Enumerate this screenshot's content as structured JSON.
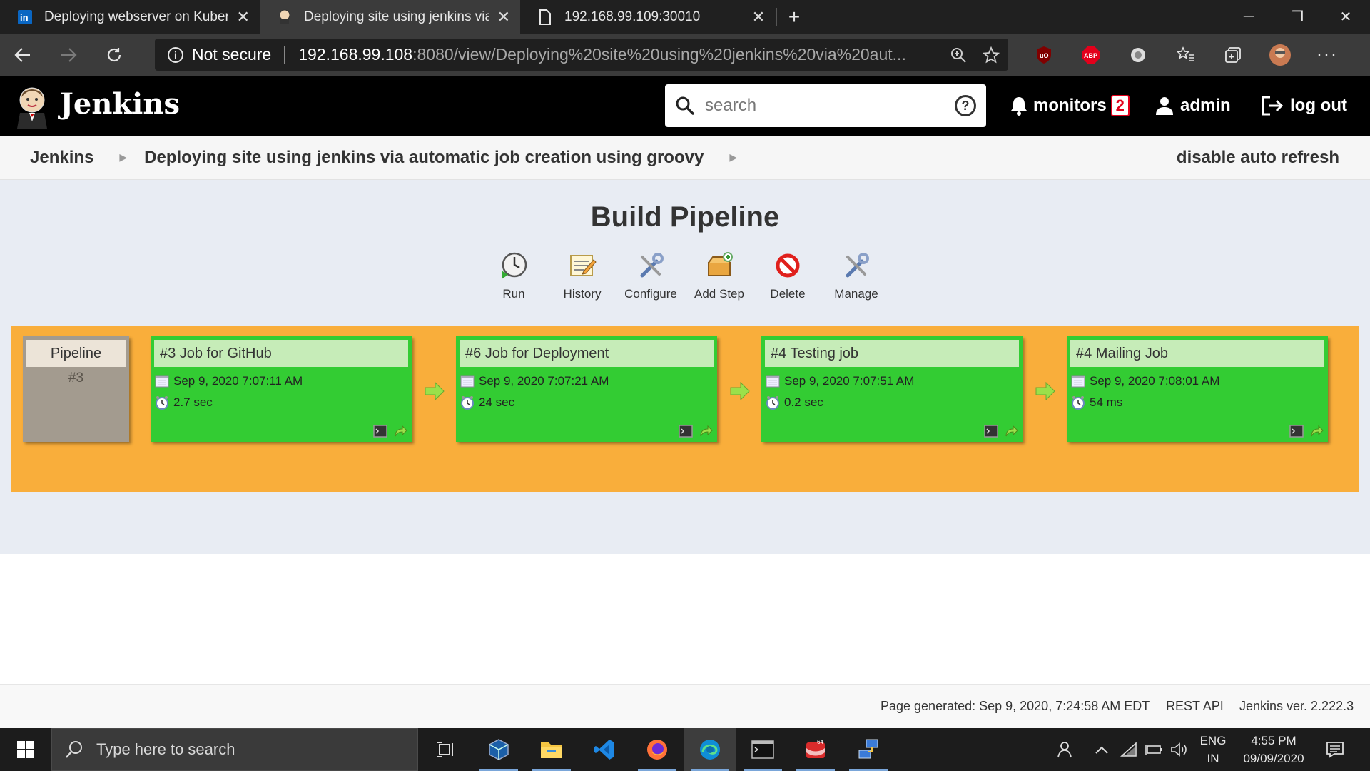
{
  "browser": {
    "tabs": [
      {
        "title": "Deploying webserver on Kubernetes",
        "icon": "linkedin-icon"
      },
      {
        "title": "Deploying site using jenkins via automatic job creation using groovy",
        "icon": "jenkins-icon"
      },
      {
        "title": "192.168.99.109:30010",
        "icon": "page-icon"
      }
    ],
    "address": {
      "security_label": "Not secure",
      "host": "192.168.99.108",
      "path": ":8080/view/Deploying%20site%20using%20jenkins%20via%20aut..."
    },
    "extensions": [
      "ublock-icon",
      "adblock-icon",
      "extension-circle-icon"
    ],
    "colors": {
      "tab_strip": "#202020",
      "toolbar": "#3b3b3b"
    }
  },
  "jenkins": {
    "brand": "Jenkins",
    "search_placeholder": "search",
    "monitors_label": "monitors",
    "monitors_count": "2",
    "user_label": "admin",
    "logout_label": "log out"
  },
  "breadcrumb": {
    "root": "Jenkins",
    "view": "Deploying site using jenkins via automatic job creation using groovy",
    "auto_refresh": "disable auto refresh"
  },
  "pipeline": {
    "title": "Build Pipeline",
    "actions": [
      {
        "label": "Run",
        "icon": "run-icon"
      },
      {
        "label": "History",
        "icon": "history-icon"
      },
      {
        "label": "Configure",
        "icon": "configure-icon"
      },
      {
        "label": "Add Step",
        "icon": "add-step-icon"
      },
      {
        "label": "Delete",
        "icon": "delete-icon"
      },
      {
        "label": "Manage",
        "icon": "manage-icon"
      }
    ],
    "head": {
      "label": "Pipeline",
      "number": "#3"
    },
    "jobs": [
      {
        "title": "#3 Job for GitHub",
        "date": "Sep 9, 2020 7:07:11 AM",
        "duration": "2.7 sec",
        "status": "success"
      },
      {
        "title": "#6 Job for Deployment",
        "date": "Sep 9, 2020 7:07:21 AM",
        "duration": "24 sec",
        "status": "success"
      },
      {
        "title": "#4 Testing job",
        "date": "Sep 9, 2020 7:07:51 AM",
        "duration": "0.2 sec",
        "status": "success"
      },
      {
        "title": "#4 Mailing Job",
        "date": "Sep 9, 2020 7:08:01 AM",
        "duration": "54 ms",
        "status": "success"
      }
    ],
    "colors": {
      "pipeline_bg": "#f9ae3b",
      "job_success": "#33cc33",
      "job_header": "#c6ecb8"
    }
  },
  "footer": {
    "generated": "Page generated: Sep 9, 2020, 7:24:58 AM EDT",
    "rest_api": "REST API",
    "version": "Jenkins ver. 2.222.3"
  },
  "taskbar": {
    "search_placeholder": "Type here to search",
    "apps": [
      "task-view-icon",
      "virtualbox-icon",
      "file-explorer-icon",
      "vscode-icon",
      "firefox-icon",
      "edge-icon",
      "terminal-icon",
      "app-icon",
      "network-app-icon"
    ],
    "lang_top": "ENG",
    "lang_bottom": "IN",
    "time": "4:55 PM",
    "date": "09/09/2020"
  }
}
